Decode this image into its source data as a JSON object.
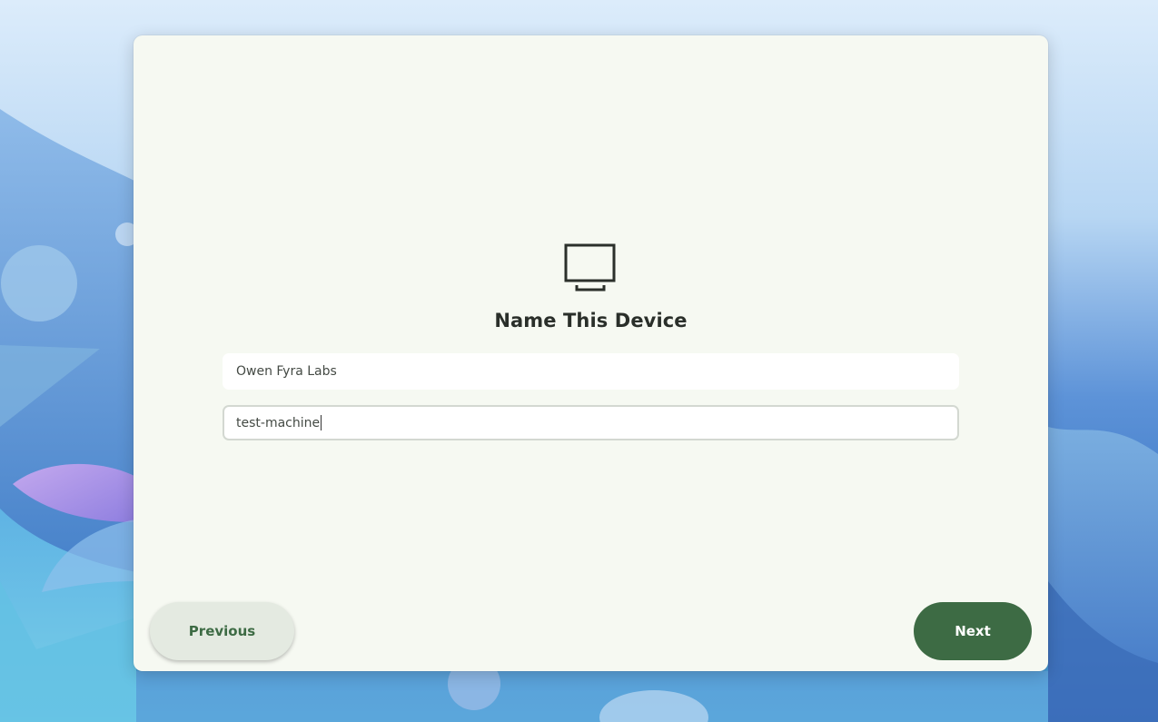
{
  "setup": {
    "title": "Name This Device",
    "company_field": {
      "value": "Owen Fyra Labs"
    },
    "device_name_field": {
      "value": "test-machine"
    },
    "previous_label": "Previous",
    "next_label": "Next"
  },
  "icons": {
    "device": "monitor-icon"
  },
  "colors": {
    "window_background": "#f6f9f2",
    "accent": "#3d6b44",
    "secondary_button": "#e4eae1"
  }
}
